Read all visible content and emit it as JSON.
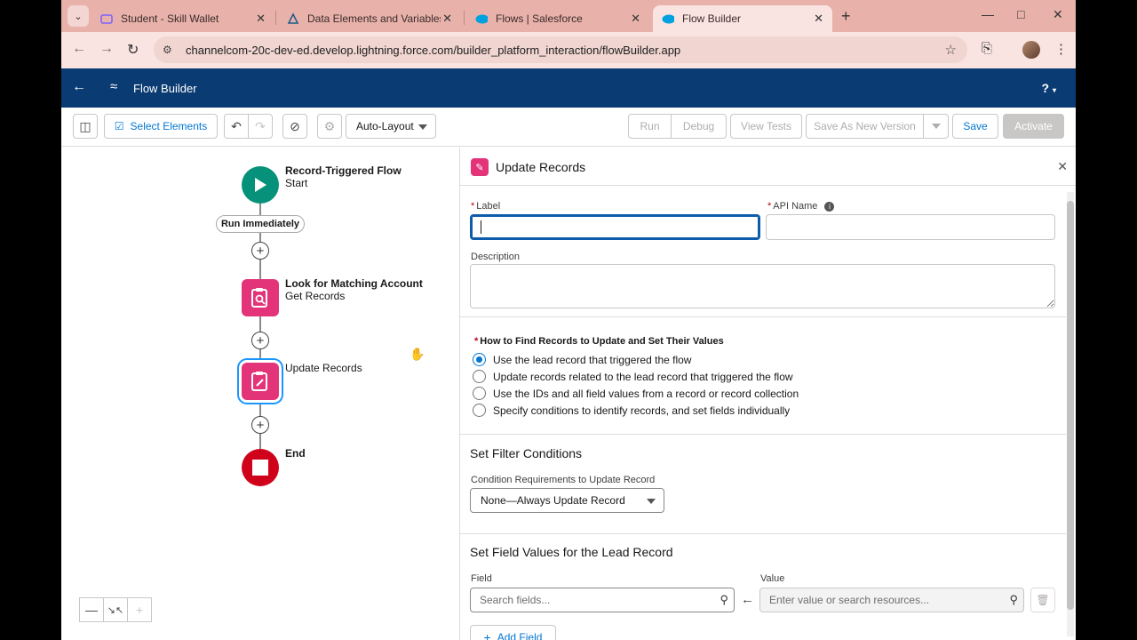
{
  "browser": {
    "tabs": [
      {
        "title": "Student - Skill Wallet",
        "icon": "skill-wallet-icon"
      },
      {
        "title": "Data Elements and Variables Gu",
        "icon": "trailhead-icon"
      },
      {
        "title": "Flows | Salesforce",
        "icon": "salesforce-cloud-icon"
      },
      {
        "title": "Flow Builder",
        "icon": "salesforce-cloud-icon"
      }
    ],
    "url": "channelcom-20c-dev-ed.develop.lightning.force.com/builder_platform_interaction/flowBuilder.app"
  },
  "app": {
    "title": "Flow Builder",
    "help_label": "?"
  },
  "toolbar": {
    "select_elements": "Select Elements",
    "layout": "Auto-Layout",
    "run": "Run",
    "debug": "Debug",
    "view_tests": "View Tests",
    "save_as_new": "Save As New Version",
    "save": "Save",
    "activate": "Activate"
  },
  "canvas": {
    "start_title": "Record-Triggered Flow",
    "start_sub": "Start",
    "run_pill": "Run Immediately",
    "get_title": "Look for Matching Account",
    "get_sub": "Get Records",
    "update_title": "Update Records",
    "end_title": "End"
  },
  "panel": {
    "title": "Update Records",
    "label_label": "Label",
    "label_value": "",
    "api_name_label": "API Name",
    "api_name_value": "",
    "description_label": "Description",
    "how_to_find": "How to Find Records to Update and Set Their Values",
    "options": [
      {
        "label": "Use the lead record that triggered the flow",
        "checked": true
      },
      {
        "label": "Update records related to the lead record that triggered the flow",
        "checked": false
      },
      {
        "label": "Use the IDs and all field values from a record or record collection",
        "checked": false
      },
      {
        "label": "Specify conditions to identify records, and set fields individually",
        "checked": false
      }
    ],
    "filter_heading": "Set Filter Conditions",
    "condition_label": "Condition Requirements to Update Record",
    "condition_value": "None—Always Update Record",
    "field_values_heading": "Set Field Values for the Lead Record",
    "field_label": "Field",
    "value_label": "Value",
    "field_placeholder": "Search fields...",
    "value_placeholder": "Enter value or search resources...",
    "add_field": "Add Field"
  }
}
